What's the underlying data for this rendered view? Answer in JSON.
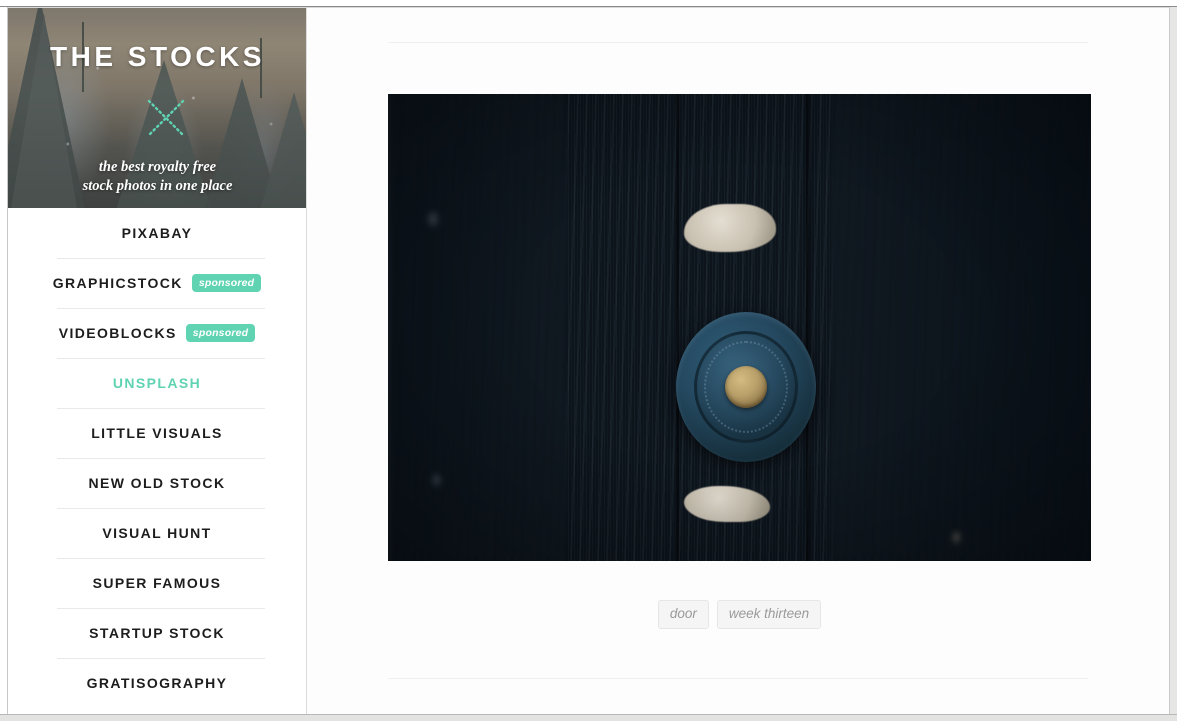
{
  "site": {
    "title": "THE STOCKS",
    "tagline_line1": "the best royalty free",
    "tagline_line2": "stock photos in one place",
    "logo_icon": "x-mark-icon",
    "accent_color": "#5fd3b2",
    "header_background": "snowy-fir-forest-photo"
  },
  "nav": {
    "items": [
      {
        "label": "PIXABAY",
        "active": false,
        "badge": ""
      },
      {
        "label": "GRAPHICSTOCK",
        "active": false,
        "badge": "sponsored"
      },
      {
        "label": "VIDEOBLOCKS",
        "active": false,
        "badge": "sponsored"
      },
      {
        "label": "UNSPLASH",
        "active": true,
        "badge": ""
      },
      {
        "label": "LITTLE VISUALS",
        "active": false,
        "badge": ""
      },
      {
        "label": "NEW OLD STOCK",
        "active": false,
        "badge": ""
      },
      {
        "label": "VISUAL HUNT",
        "active": false,
        "badge": ""
      },
      {
        "label": "SUPER FAMOUS",
        "active": false,
        "badge": ""
      },
      {
        "label": "STARTUP STOCK",
        "active": false,
        "badge": ""
      },
      {
        "label": "GRATISOGRAPHY",
        "active": false,
        "badge": ""
      }
    ]
  },
  "main": {
    "photo": {
      "alt": "weathered blue wooden door with vintage doorbell and brass button",
      "width": "703",
      "height": "467"
    },
    "tags": [
      {
        "label": "door"
      },
      {
        "label": "week thirteen"
      }
    ]
  }
}
